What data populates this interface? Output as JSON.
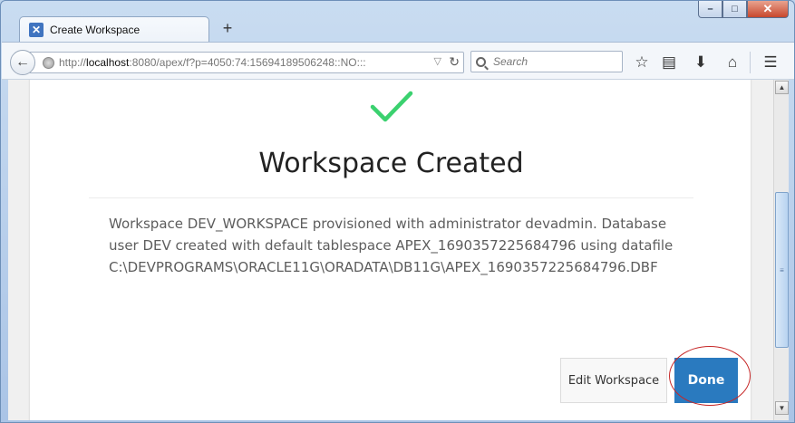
{
  "browser": {
    "tab_title": "Create Workspace",
    "new_tab_label": "+",
    "url_prefix": "http://",
    "url_host": "localhost",
    "url_rest": ":8080/apex/f?p=4050:74:15694189506248::NO:::",
    "search_placeholder": "Search",
    "window_controls": {
      "minimize": "–",
      "maximize": "□",
      "close": "✕"
    }
  },
  "page": {
    "title": "Workspace Created",
    "message": "Workspace DEV_WORKSPACE provisioned with administrator devadmin. Database user DEV created with default tablespace APEX_1690357225684796 using datafile C:\\DEVPROGRAMS\\ORACLE11G\\ORADATA\\DB11G\\APEX_1690357225684796.DBF",
    "buttons": {
      "edit": "Edit Workspace",
      "done": "Done"
    }
  },
  "colors": {
    "check": "#3bd16f",
    "done_button": "#2a7abf",
    "highlight_circle": "#c62828"
  },
  "icons": [
    "back-arrow-icon",
    "globe-icon",
    "search-icon",
    "bookmark-star-icon",
    "reading-list-icon",
    "download-icon",
    "home-icon",
    "menu-icon",
    "checkmark-icon"
  ]
}
